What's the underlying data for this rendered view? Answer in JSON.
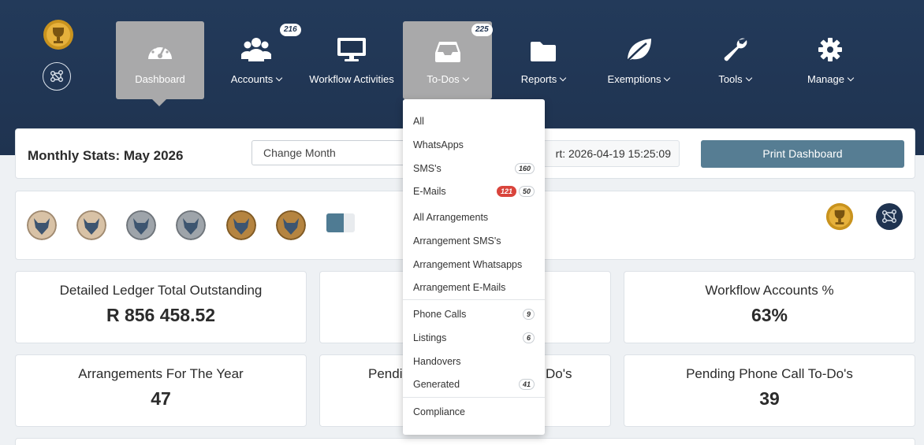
{
  "nav": {
    "items": [
      {
        "label": "Dashboard",
        "icon": "dashboard-gauge-icon"
      },
      {
        "label": "Accounts",
        "icon": "users-icon",
        "badge": "216"
      },
      {
        "label": "Workflow Activities",
        "icon": "monitor-icon"
      },
      {
        "label": "To-Dos",
        "icon": "inbox-icon",
        "badge": "225"
      },
      {
        "label": "Reports",
        "icon": "folder-icon"
      },
      {
        "label": "Exemptions",
        "icon": "leaf-icon"
      },
      {
        "label": "Tools",
        "icon": "wrench-icon"
      },
      {
        "label": "Manage",
        "icon": "gear-icon"
      }
    ]
  },
  "stats": {
    "title": "Monthly Stats: May 2026",
    "month_placeholder": "Change Month",
    "date_text": "rt: 2026-04-19 15:25:09",
    "print_label": "Print Dashboard"
  },
  "badges": {
    "progress_percent": 0.6
  },
  "cards": [
    {
      "title": "Detailed Ledger Total Outstanding",
      "value": "R 856 458.52"
    },
    {
      "title": "",
      "value": ""
    },
    {
      "title": "Workflow Accounts %",
      "value": "63%"
    },
    {
      "title": "Arrangements For The Year",
      "value": "47"
    },
    {
      "title": "Pendi",
      "title_right": "Do's",
      "value": ""
    },
    {
      "title": "Pending Phone Call To-Do's",
      "value": "39"
    }
  ],
  "todo_menu": {
    "items": [
      {
        "label": "All"
      },
      {
        "label": "WhatsApps"
      },
      {
        "label": "SMS's",
        "count": "160"
      },
      {
        "label": "E-Mails",
        "count_red": "121",
        "count": "50"
      },
      {
        "label": "All Arrangements"
      },
      {
        "label": "Arrangement SMS's"
      },
      {
        "label": "Arrangement Whatsapps"
      },
      {
        "label": "Arrangement E-Mails"
      },
      {
        "label": "Phone Calls",
        "count": "9"
      },
      {
        "label": "Listings",
        "count": "6"
      },
      {
        "label": "Handovers"
      },
      {
        "label": "Generated",
        "count": "41"
      },
      {
        "label": "Compliance"
      }
    ]
  },
  "colors": {
    "header_bg": "#1f3350",
    "active_tab": "#a9a9aa",
    "print_button": "#567d93",
    "red_badge": "#d9443c"
  }
}
